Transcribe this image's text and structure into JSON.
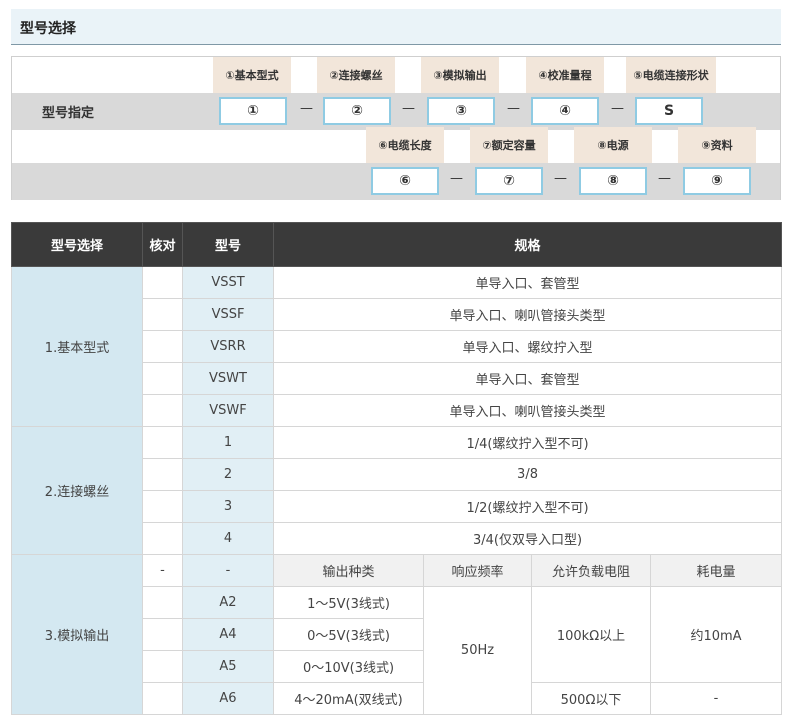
{
  "section_title": "型号选择",
  "spec": {
    "label": "型号指定",
    "row1": [
      {
        "caption": "①基本型式",
        "slot": "①"
      },
      {
        "caption": "②连接螺丝",
        "slot": "②"
      },
      {
        "caption": "③模拟输出",
        "slot": "③"
      },
      {
        "caption": "④校准量程",
        "slot": "④"
      },
      {
        "caption": "⑤电缆连接形状",
        "slot": "S"
      }
    ],
    "row2": [
      {
        "caption": "⑥电缆长度",
        "slot": "⑥"
      },
      {
        "caption": "⑦额定容量",
        "slot": "⑦"
      },
      {
        "caption": "⑧电源",
        "slot": "⑧"
      },
      {
        "caption": "⑨资料",
        "slot": "⑨"
      }
    ],
    "dash": "—"
  },
  "table": {
    "headers": [
      "型号选择",
      "核对",
      "型号",
      "规格"
    ],
    "groups": {
      "basic": {
        "name": "1.基本型式",
        "rows": [
          {
            "model": "VSST",
            "spec": "单导入口、套管型"
          },
          {
            "model": "VSSF",
            "spec": "单导入口、喇叭管接头类型"
          },
          {
            "model": "VSRR",
            "spec": "单导入口、螺纹拧入型"
          },
          {
            "model": "VSWT",
            "spec": "单导入口、套管型"
          },
          {
            "model": "VSWF",
            "spec": "单导入口、喇叭管接头类型"
          }
        ]
      },
      "thread": {
        "name": "2.连接螺丝",
        "rows": [
          {
            "model": "1",
            "spec": "1/4(螺纹拧入型不可)"
          },
          {
            "model": "2",
            "spec": "3/8"
          },
          {
            "model": "3",
            "spec": "1/2(螺纹拧入型不可)"
          },
          {
            "model": "4",
            "spec": "3/4(仅双导入口型)"
          }
        ]
      },
      "analog": {
        "name": "3.模拟输出",
        "sub_check": "-",
        "sub_model": "-",
        "sub_headers": [
          "输出种类",
          "响应频率",
          "允许负载电阻",
          "耗电量"
        ],
        "rows": [
          {
            "model": "A2",
            "type": "1～5V(3线式)"
          },
          {
            "model": "A4",
            "type": "0～5V(3线式)"
          },
          {
            "model": "A5",
            "type": "0～10V(3线式)"
          },
          {
            "model": "A6",
            "type": "4～20mA(双线式)"
          }
        ],
        "freq": "50Hz",
        "load_1": "100kΩ以上",
        "power_1": "约10mA",
        "load_2": "500Ω以下",
        "power_2": "-"
      }
    }
  }
}
